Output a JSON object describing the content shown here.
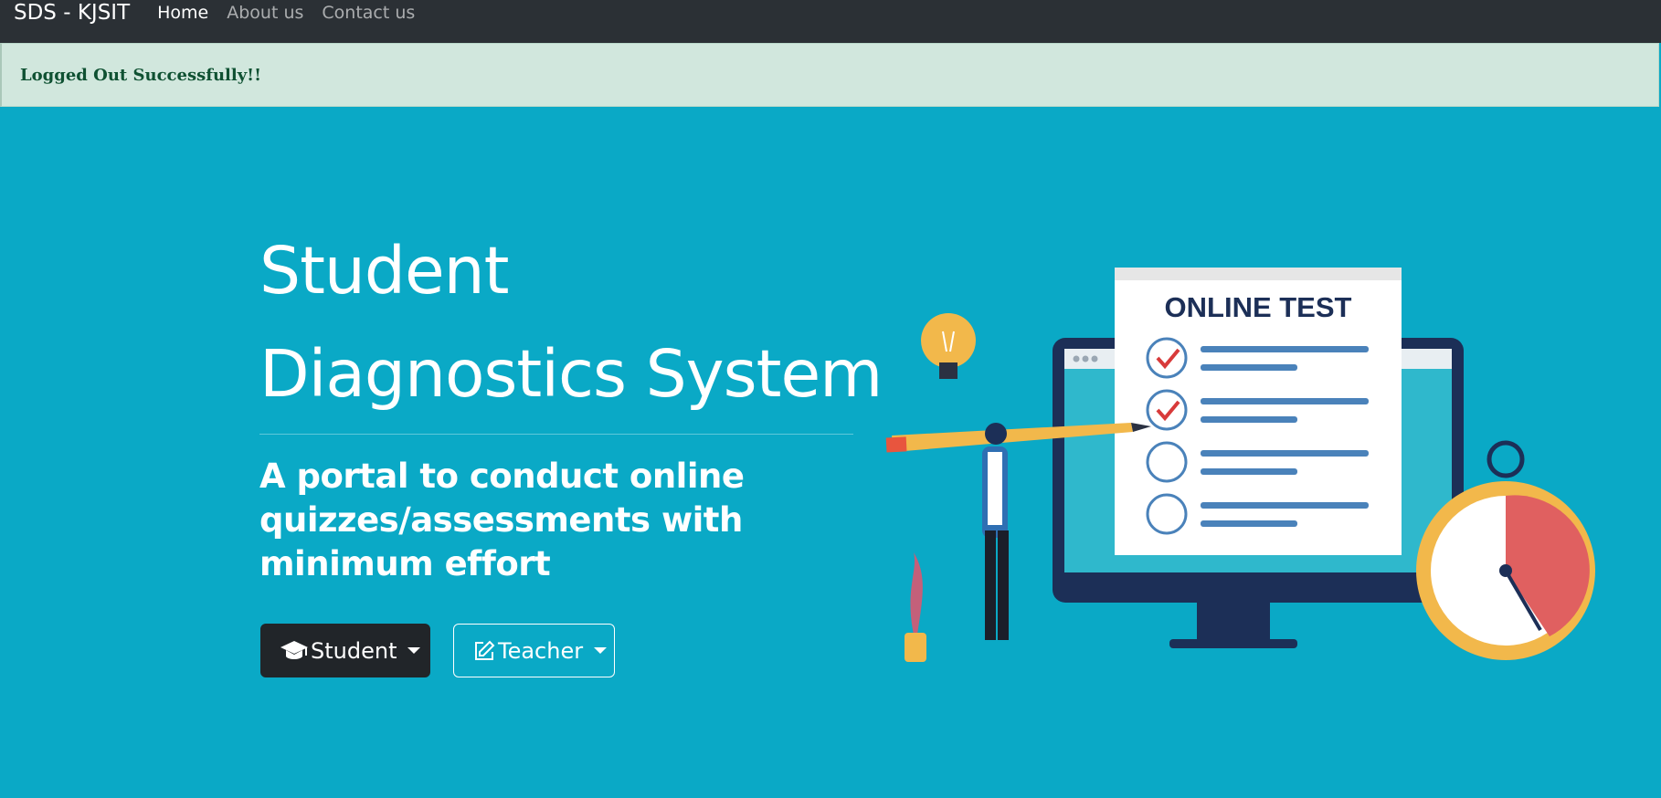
{
  "navbar": {
    "brand": "SDS - KJSIT",
    "links": [
      {
        "label": "Home",
        "active": true
      },
      {
        "label": "About us",
        "active": false
      },
      {
        "label": "Contact us",
        "active": false
      }
    ]
  },
  "alert": {
    "message": "Logged Out Successfully!!",
    "color": "#0f5132",
    "background": "#d1e7dd"
  },
  "hero": {
    "title_line1": "Student",
    "title_line2": "Diagnostics System",
    "subtitle": "A portal to conduct online quizzes/assessments with minimum effort",
    "background": "#0aa9c6"
  },
  "buttons": {
    "student": {
      "label": "Student",
      "icon": "graduation-cap-icon"
    },
    "teacher": {
      "label": "Teacher",
      "icon": "edit-icon"
    }
  },
  "illustration": {
    "heading": "ONLINE TEST"
  }
}
